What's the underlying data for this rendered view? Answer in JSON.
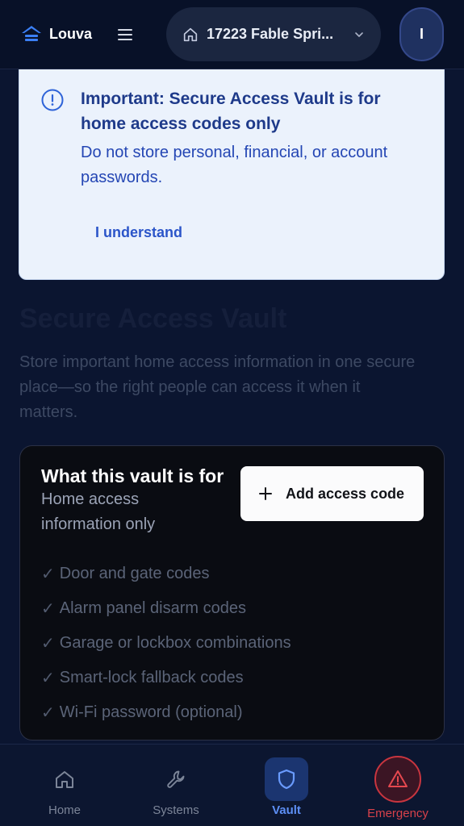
{
  "header": {
    "brand": "Louva",
    "address": "17223 Fable Spri...",
    "avatar_initial": "I"
  },
  "notice": {
    "title": "Important: Secure Access Vault is for home access codes only",
    "body": "Do not store personal, financial, or account passwords.",
    "button": "I understand"
  },
  "intro": {
    "title": "Secure Access Vault",
    "description": "Store important home access information in one secure place—so the right people can access it when it matters."
  },
  "vault_info": {
    "title": "What this vault is for",
    "subtitle": "Home access information only",
    "add_button": "Add access code",
    "items": [
      "Door and gate codes",
      "Alarm panel disarm codes",
      "Garage or lockbox combinations",
      "Smart-lock fallback codes",
      "Wi-Fi password (optional)"
    ]
  },
  "nav": {
    "home": "Home",
    "systems": "Systems",
    "vault": "Vault",
    "emergency": "Emergency"
  },
  "colors": {
    "background": "#0b1530",
    "notice_bg": "#ebf2fc",
    "accent_blue": "#5d8ff5",
    "emergency_red": "#d8414a"
  }
}
